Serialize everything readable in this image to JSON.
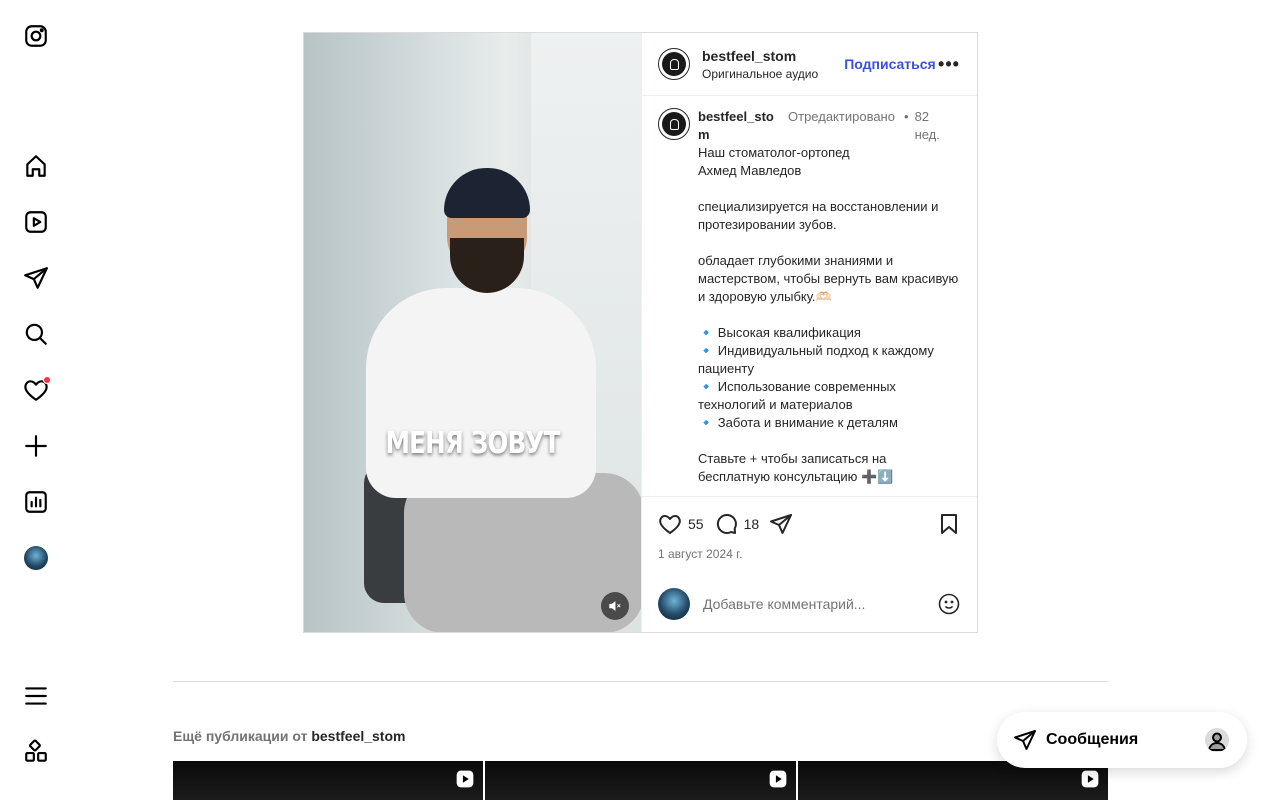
{
  "sidebar": {
    "items": [
      {
        "name": "instagram-logo-icon"
      },
      {
        "name": "home-icon"
      },
      {
        "name": "reels-icon"
      },
      {
        "name": "direct-icon"
      },
      {
        "name": "search-icon"
      },
      {
        "name": "notifications-heart-icon"
      },
      {
        "name": "create-plus-icon"
      },
      {
        "name": "dashboard-icon"
      },
      {
        "name": "profile-avatar"
      },
      {
        "name": "menu-hamburger-icon"
      },
      {
        "name": "also-from-meta-icon"
      }
    ],
    "notification_dot_color": "#ff3040"
  },
  "post": {
    "media": {
      "overlay_text": "МЕНЯ ЗОВУТ",
      "mute_icon": "speaker-muted-icon"
    },
    "header": {
      "username": "bestfeel_stom",
      "audio": "Оригинальное аудио",
      "follow_label": "Подписаться",
      "more_label": "•••",
      "follow_color": "#3a52d8"
    },
    "caption": {
      "username": "bestfeel_stom",
      "edited": "Отредактировано",
      "dot": "•",
      "time_ago": "82 нед.",
      "lines": [
        "Наш стоматолог-ортопед",
        "Ахмед Мавледов",
        "",
        "специализируется на восстановлении и протезировании зубов.",
        "",
        "обладает глубокими знаниями и мастерством, чтобы вернуть вам красивую и здоровую улыбку.🫶🏻",
        "",
        "🔹 Высокая квалификация",
        "🔹 Индивидуальный подход к каждому пациенту",
        "🔹 Использование современных технологий и материалов",
        "🔹 Забота и внимание к деталям",
        "",
        "Ставьте + чтобы записаться на бесплатную консультацию ➕⬇️"
      ]
    },
    "actions": {
      "likes": "55",
      "comments": "18",
      "date": "1 август 2024 г."
    },
    "comment_box": {
      "placeholder": "Добавьте комментарий..."
    }
  },
  "more_posts": {
    "prefix": "Ещё публикации от",
    "username": "bestfeel_stom",
    "items": [
      {
        "badge": "reel-icon"
      },
      {
        "badge": "reel-icon"
      },
      {
        "badge": "reel-icon"
      }
    ]
  },
  "messages": {
    "label": "Сообщения"
  }
}
